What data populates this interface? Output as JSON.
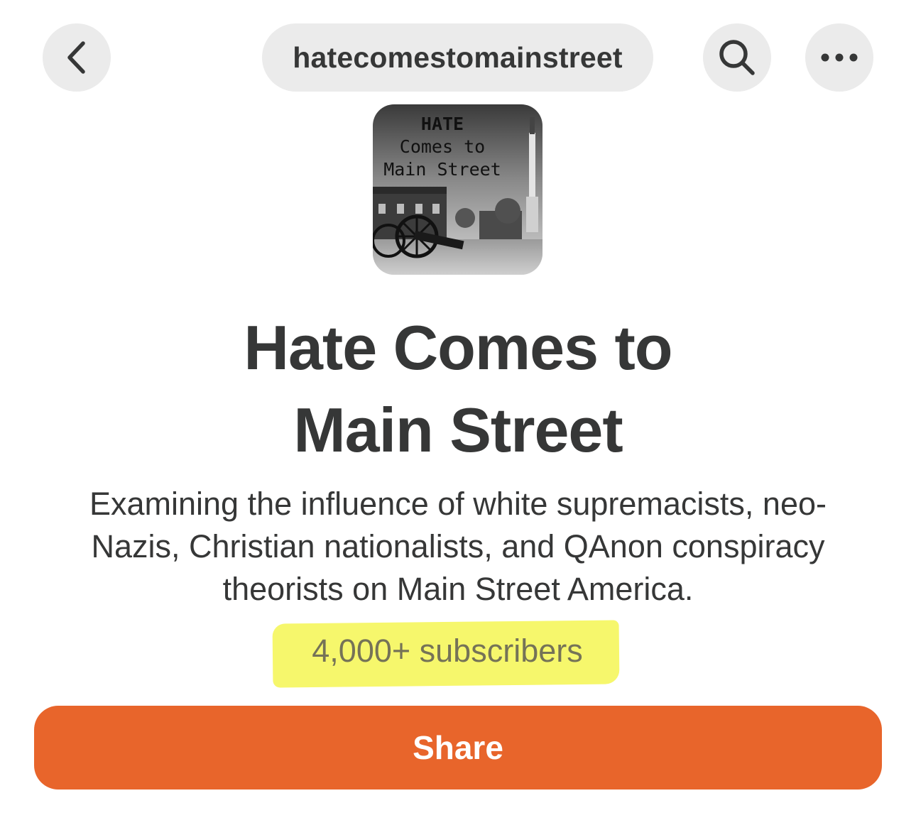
{
  "nav": {
    "url": "hatecomestomainstreet",
    "icons": {
      "back": "chevron-left-icon",
      "search": "search-icon",
      "more": "more-horizontal-icon"
    }
  },
  "logo": {
    "line1": "HATE",
    "line2": "Comes to",
    "line3": "Main Street"
  },
  "publication": {
    "title_line1": "Hate Comes to",
    "title_line2": "Main Street",
    "description_line1": "Examining the influence of white supremacists, neo-",
    "description_line2": "Nazis, Christian nationalists, and QAnon conspiracy",
    "description_line3": "theorists on Main Street America.",
    "subscribers": "4,000+ subscribers"
  },
  "actions": {
    "share_label": "Share"
  },
  "colors": {
    "accent": "#e8652b",
    "pill_bg": "#ebebeb",
    "text": "#363737",
    "highlight": "#f6f76c"
  }
}
